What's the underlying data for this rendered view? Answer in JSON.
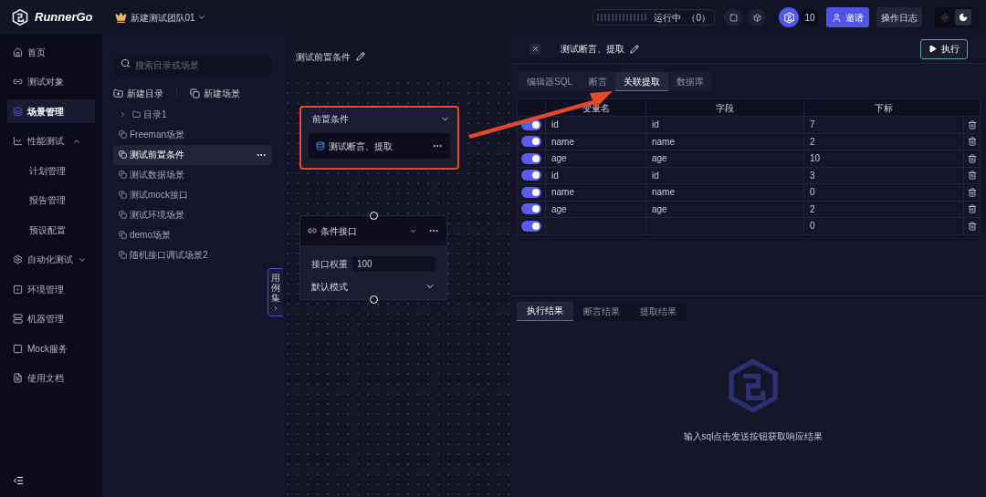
{
  "header": {
    "brand": "RunnerGo",
    "team": "新建测试团队01",
    "running_label": "运行中",
    "running_count": "（0）",
    "member_count": "10",
    "invite": "邀请",
    "log_button": "操作日志",
    "theme": [
      {
        "kind": "light",
        "selected": false
      },
      {
        "kind": "dark",
        "selected": true
      }
    ]
  },
  "sidebar": {
    "items": [
      {
        "label": "首页",
        "selected": false
      },
      {
        "label": "测试对象",
        "selected": false
      },
      {
        "label": "场景管理",
        "selected": true
      },
      {
        "label": "性能测试",
        "selected": false,
        "expanded": true,
        "children": [
          {
            "label": "计划管理",
            "selected": false
          },
          {
            "label": "报告管理",
            "selected": false
          },
          {
            "label": "预设配置",
            "selected": false
          }
        ]
      },
      {
        "label": "自动化测试",
        "selected": false,
        "expanded": false
      },
      {
        "label": "环境管理",
        "selected": false
      },
      {
        "label": "机器管理",
        "selected": false
      },
      {
        "label": "Mock服务",
        "selected": false
      },
      {
        "label": "使用文档",
        "selected": false
      }
    ]
  },
  "tree": {
    "search_placeholder": "搜索目录或场景",
    "actions": [
      "新建目录",
      "新建场景"
    ],
    "items": [
      {
        "kind": "folder",
        "label": "目录1",
        "expanded": false,
        "selected": false
      },
      {
        "kind": "scene",
        "label": "Freeman场景",
        "selected": false
      },
      {
        "kind": "scene",
        "label": "测试前置条件",
        "selected": true
      },
      {
        "kind": "scene",
        "label": "测试数据场景",
        "selected": false
      },
      {
        "kind": "scene",
        "label": "测试mock接口",
        "selected": false
      },
      {
        "kind": "scene",
        "label": "测试环境场景",
        "selected": false
      },
      {
        "kind": "scene",
        "label": "demo场景",
        "selected": false
      },
      {
        "kind": "scene",
        "label": "随机接口调试场景2",
        "selected": false
      }
    ],
    "side_tab": "用例集"
  },
  "canvas": {
    "title": "测试前置条件",
    "nodes": [
      {
        "kind": "condition_group",
        "title": "前置条件",
        "highlighted": true,
        "child": "测试断言、提取"
      },
      {
        "kind": "api",
        "title": "条件接口",
        "highlighted": false,
        "weight_label": "接口权重",
        "weight": "100",
        "mode": "默认模式"
      }
    ]
  },
  "drawer": {
    "title": "测试断言、提取",
    "run_button": "执行",
    "tabs": [
      {
        "label": "编辑器SQL",
        "selected": false
      },
      {
        "label": "断言",
        "selected": false
      },
      {
        "label": "关联提取",
        "selected": true
      },
      {
        "label": "数据库",
        "selected": false
      }
    ],
    "table": {
      "columns": [
        "变量名",
        "字段",
        "下标"
      ],
      "rows": [
        {
          "on": true,
          "name": "id",
          "field": "id",
          "index": "7"
        },
        {
          "on": true,
          "name": "name",
          "field": "name",
          "index": "2"
        },
        {
          "on": true,
          "name": "age",
          "field": "age",
          "index": "10"
        },
        {
          "on": true,
          "name": "id",
          "field": "id",
          "index": "3"
        },
        {
          "on": true,
          "name": "name",
          "field": "name",
          "index": "0"
        },
        {
          "on": true,
          "name": "age",
          "field": "age",
          "index": "2"
        },
        {
          "on": true,
          "index": "0"
        }
      ]
    },
    "result_tabs": [
      {
        "label": "执行结果",
        "selected": true
      },
      {
        "label": "断言结果",
        "selected": false
      },
      {
        "label": "提取结果",
        "selected": false
      }
    ],
    "empty_text": "输入sql点击发送按钮获取响应结果"
  }
}
